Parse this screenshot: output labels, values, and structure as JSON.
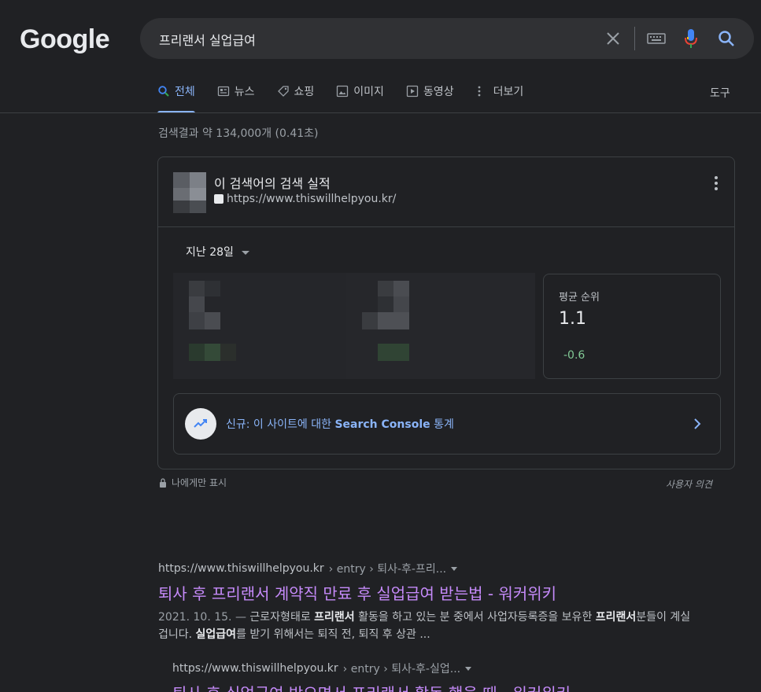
{
  "header": {
    "logo": "Google",
    "query": "프리랜서 실업급여"
  },
  "tabs": [
    {
      "label": "전체",
      "icon": "search-icon",
      "active": true
    },
    {
      "label": "뉴스",
      "icon": "news-icon"
    },
    {
      "label": "쇼핑",
      "icon": "tag-icon"
    },
    {
      "label": "이미지",
      "icon": "image-icon"
    },
    {
      "label": "동영상",
      "icon": "play-icon"
    },
    {
      "label": "더보기",
      "icon": "more-vert-icon"
    }
  ],
  "tools_label": "도구",
  "stats": "검색결과 약 134,000개 (0.41초)",
  "card": {
    "title": "이 검색어의 검색 실적",
    "url": "https://www.thiswillhelpyou.kr/",
    "period": "지난 28일",
    "rank_label": "평균 순위",
    "rank_value": "1.1",
    "rank_change": "-0.6",
    "console_prefix": "신규: 이 사이트에 대한 ",
    "console_bold": "Search Console",
    "console_suffix": " 통계"
  },
  "private_label": "나에게만 표시",
  "feedback_label": "사용자 의견",
  "results": [
    {
      "url": "https://www.thiswillhelpyou.kr",
      "crumb": "› entry › 퇴사-후-프리...",
      "title": "퇴사 후 프리랜서 계약직 만료 후 실업급여 받는법 - 워커위키",
      "date": "2021. 10. 15. — ",
      "snippet_1": "근로자형태로 ",
      "snippet_b1": "프리랜서",
      "snippet_2": " 활동을 하고 있는 분 중에서 사업자등록증을 보유한 ",
      "snippet_b2": "프리랜서",
      "snippet_3": "분들이 계실겁니다. ",
      "snippet_b3": "실업급여",
      "snippet_4": "를 받기 위해서는 퇴직 전, 퇴직 후 상관 ..."
    },
    {
      "url": "https://www.thiswillhelpyou.kr",
      "crumb": "› entry › 퇴사-후-실업...",
      "title": "퇴사 후 실업급여 받으면서 프리랜서 활동 했을 때 - 워커위키"
    }
  ]
}
